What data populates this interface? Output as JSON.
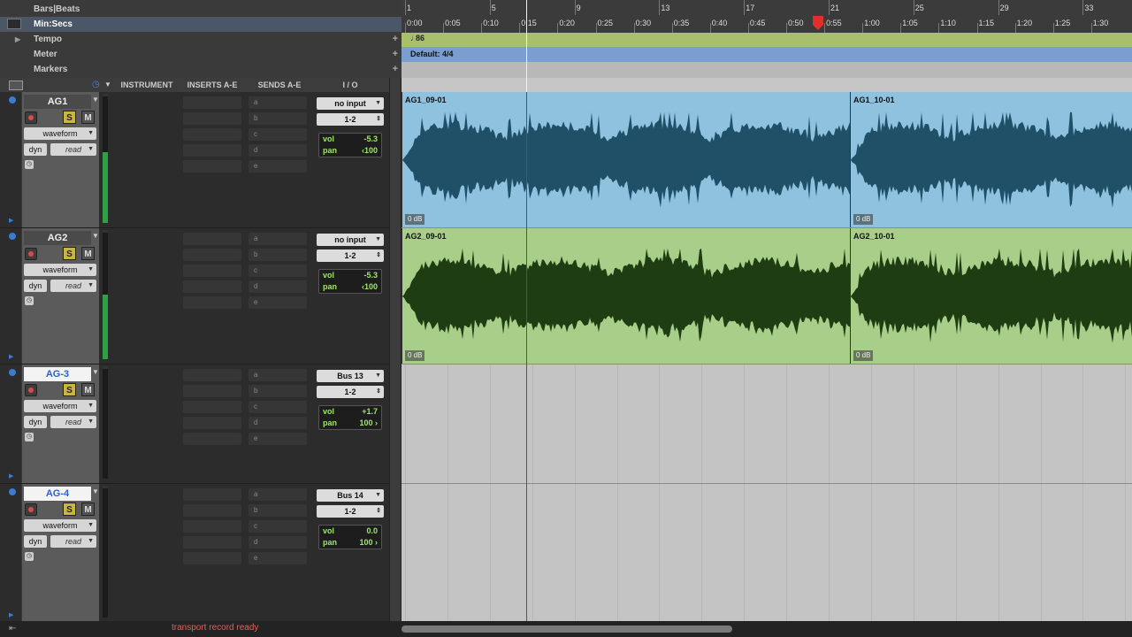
{
  "rulers": [
    {
      "name": "Bars|Beats"
    },
    {
      "name": "Min:Secs"
    },
    {
      "name": "Tempo"
    },
    {
      "name": "Meter"
    },
    {
      "name": "Markers"
    }
  ],
  "bars": [
    "1",
    "5",
    "9",
    "13",
    "17",
    "21",
    "25",
    "29",
    "33"
  ],
  "minsecs": [
    "0:00",
    "0:05",
    "0:10",
    "0:15",
    "0:20",
    "0:25",
    "0:30",
    "0:35",
    "0:40",
    "0:45",
    "0:50",
    "0:55",
    "1:00",
    "1:05",
    "1:10",
    "1:15",
    "1:20",
    "1:25",
    "1:30"
  ],
  "tempo_value": "86",
  "meter_value": "Default: 4/4",
  "columns": {
    "instrument": "INSTRUMENT",
    "inserts": "INSERTS A-E",
    "sends": "SENDS A-E",
    "io": "I / O"
  },
  "send_letters": [
    "a",
    "b",
    "c",
    "d",
    "e"
  ],
  "tracks": [
    {
      "name": "AG1",
      "selected": false,
      "view": "waveform",
      "dyn": "dyn",
      "auto": "read",
      "input": "no input",
      "output": "1-2",
      "vol_label": "vol",
      "vol": "-5.3",
      "pan_label": "pan",
      "pan": "‹100",
      "solo": "S",
      "mute": "M",
      "meter_level": 0.55,
      "regions": [
        {
          "name": "AG1_09-01",
          "gain": "0 dB"
        },
        {
          "name": "AG1_10-01",
          "gain": "0 dB"
        }
      ]
    },
    {
      "name": "AG2",
      "selected": false,
      "view": "waveform",
      "dyn": "dyn",
      "auto": "read",
      "input": "no input",
      "output": "1-2",
      "vol_label": "vol",
      "vol": "-5.3",
      "pan_label": "pan",
      "pan": "‹100",
      "solo": "S",
      "mute": "M",
      "meter_level": 0.5,
      "regions": [
        {
          "name": "AG2_09-01",
          "gain": "0 dB"
        },
        {
          "name": "AG2_10-01",
          "gain": "0 dB"
        }
      ]
    },
    {
      "name": "AG-3",
      "selected": true,
      "view": "waveform",
      "dyn": "dyn",
      "auto": "read",
      "input": "Bus 13",
      "output": "1-2",
      "vol_label": "vol",
      "vol": "+1.7",
      "pan_label": "pan",
      "pan": "100 ›",
      "solo": "S",
      "mute": "M",
      "meter_level": 0,
      "regions": []
    },
    {
      "name": "AG-4",
      "selected": true,
      "view": "waveform",
      "dyn": "dyn",
      "auto": "read",
      "input": "Bus 14",
      "output": "1-2",
      "vol_label": "vol",
      "vol": "0.0",
      "pan_label": "pan",
      "pan": "100 ›",
      "solo": "S",
      "mute": "M",
      "meter_level": 0,
      "regions": []
    }
  ],
  "status": "transport record ready",
  "colors": {
    "audio_blue": "#8ec2df",
    "wave_blue": "#1f5068",
    "audio_green": "#a8cf8a",
    "wave_green": "#1f3d12",
    "tempo": "#a8c06b",
    "meter": "#7b9ed1",
    "status": "#e0605a"
  }
}
